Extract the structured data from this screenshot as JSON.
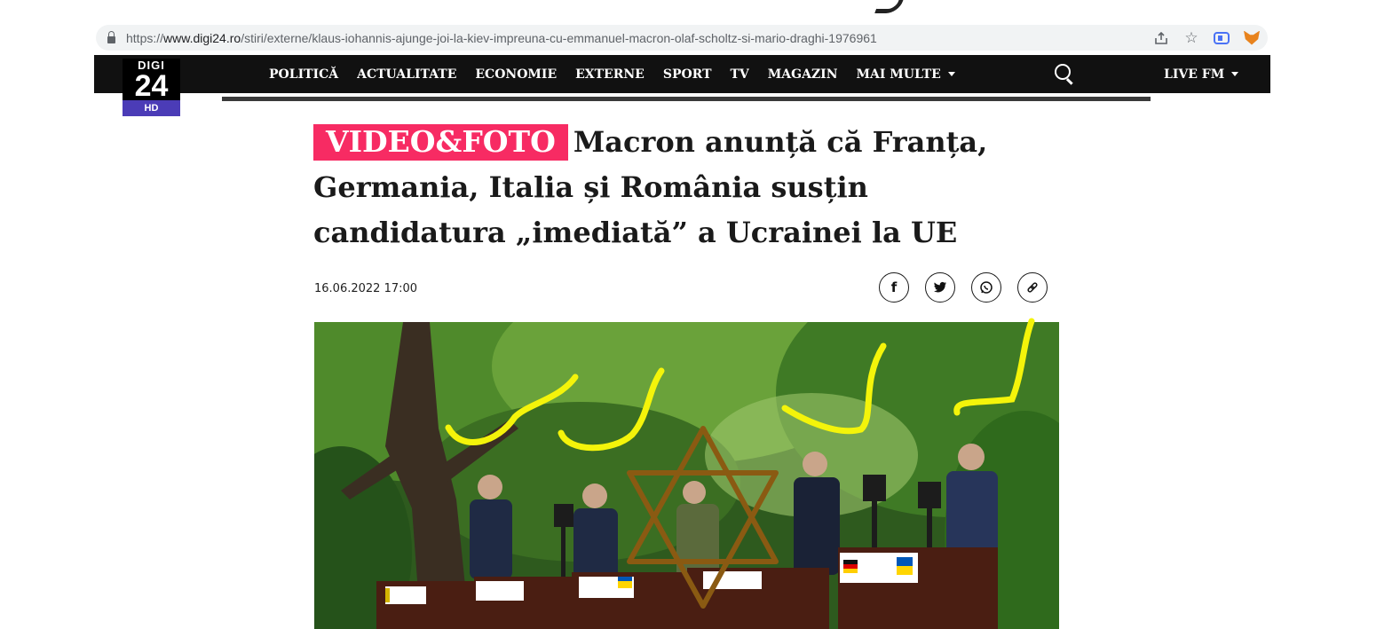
{
  "browser": {
    "url_prefix": "https://",
    "url_host": "www.digi24.ro",
    "url_path": "/stiri/externe/klaus-iohannis-ajunge-joi-la-kiev-impreuna-cu-emmanuel-macron-olaf-scholtz-si-mario-draghi-1976961"
  },
  "site": {
    "logo_top": "DIGI",
    "logo_number": "24",
    "logo_hd": "HD",
    "menu": [
      "POLITICĂ",
      "ACTUALITATE",
      "ECONOMIE",
      "EXTERNE",
      "SPORT",
      "TV",
      "MAGAZIN",
      "MAI MULTE"
    ],
    "live": "LIVE FM"
  },
  "article": {
    "tag": "VIDEO&FOTO",
    "title": "Macron anunță că Franța, Germania, Italia și România susțin candidatura „imediată” a Ucrainei la UE",
    "date": "16.06.2022 17:00"
  },
  "share": {
    "facebook": "f",
    "twitter": "twitter-icon",
    "whatsapp": "whatsapp-icon",
    "link": "link-icon"
  },
  "colors": {
    "nav_bg": "#111111",
    "tag_bg": "#f72b63",
    "logo_hd": "#4b3cb7",
    "scribble_yellow": "#f4f40a",
    "star_brown": "#8a5a12"
  }
}
